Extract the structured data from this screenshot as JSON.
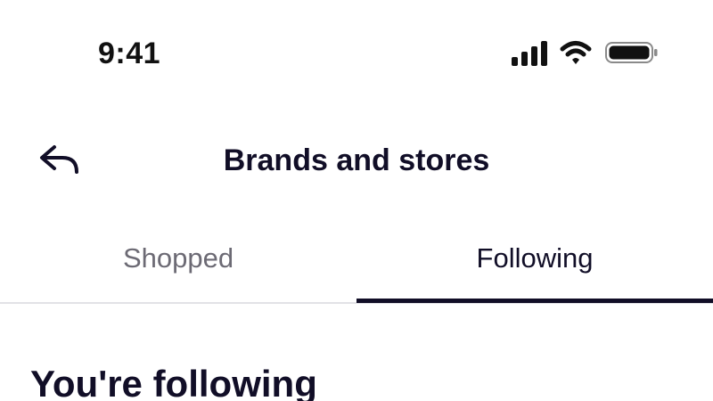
{
  "status_bar": {
    "time": "9:41",
    "icons": [
      "signal-icon",
      "wifi-icon",
      "battery-icon"
    ]
  },
  "header": {
    "back_icon": "back-arrow-icon",
    "title": "Brands and stores"
  },
  "tabs": [
    {
      "label": "Shopped",
      "active": false
    },
    {
      "label": "Following",
      "active": true
    }
  ],
  "main": {
    "section_heading": "You're following"
  },
  "colors": {
    "primary_text": "#110e27",
    "inactive_tab_text": "#6c6a74",
    "active_indicator": "#110e27",
    "divider": "#e2e2e6",
    "background": "#ffffff"
  }
}
